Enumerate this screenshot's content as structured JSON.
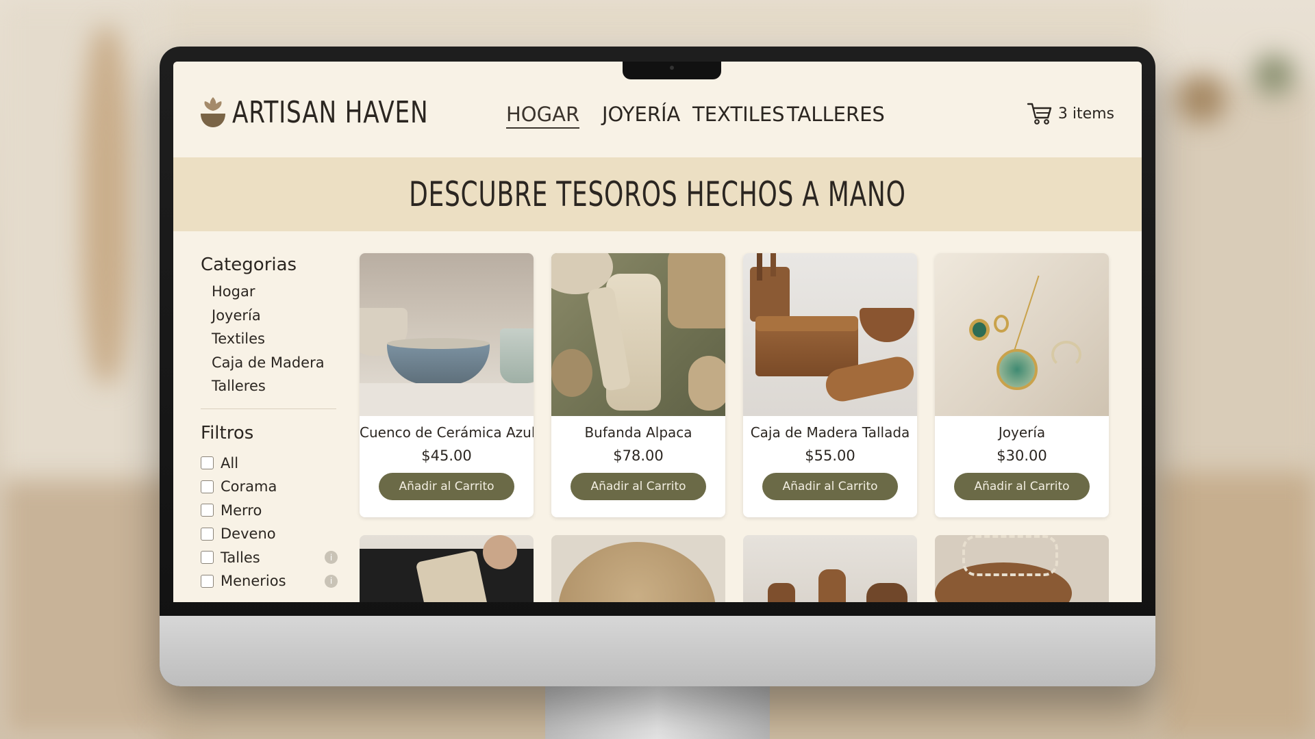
{
  "brand": {
    "name": "ARTISAN HAVEN"
  },
  "nav": {
    "items": [
      "HOGAR",
      "JOYERÍA",
      "TEXTILES",
      "TALLERES"
    ],
    "active": "HOGAR"
  },
  "cart": {
    "label": "3 items"
  },
  "banner": {
    "title": "DESCUBRE TESOROS HECHOS A MANO"
  },
  "sidebar": {
    "categories_heading": "Categorias",
    "categories": [
      "Hogar",
      "Joyería",
      "Textiles",
      "Caja de Madera",
      "Talleres"
    ],
    "filters_heading": "Filtros",
    "filters": [
      "All",
      "Corama",
      "Merro",
      "Deveno",
      "Talles",
      "Menerios"
    ]
  },
  "products": [
    {
      "name": "Cuenco de Cerámica Azul",
      "price": "$45.00",
      "button": "Añadir al Carrito"
    },
    {
      "name": "Bufanda Alpaca",
      "price": "$78.00",
      "button": "Añadir al Carrito"
    },
    {
      "name": "Caja de Madera Tallada",
      "price": "$55.00",
      "button": "Añadir al Carrito"
    },
    {
      "name": "Joyería",
      "price": "$30.00",
      "button": "Añadir al Carrito"
    }
  ],
  "colors": {
    "accent": "#6b6a47",
    "banner": "#ecdfc3",
    "page": "#f8f2e6",
    "text": "#2b2621"
  },
  "icons": {
    "logo": "bowl-sprout-icon",
    "cart": "cart-icon",
    "info": "info-icon"
  }
}
